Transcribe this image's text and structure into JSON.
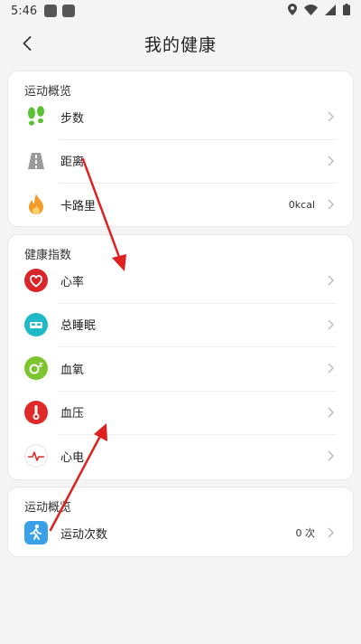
{
  "status": {
    "time": "5:46"
  },
  "header": {
    "title": "我的健康"
  },
  "section1": {
    "title": "运动概览",
    "items": [
      {
        "label": "步数",
        "value": ""
      },
      {
        "label": "距离",
        "value": ""
      },
      {
        "label": "卡路里",
        "value": "0kcal"
      }
    ]
  },
  "section2": {
    "title": "健康指数",
    "items": [
      {
        "label": "心率"
      },
      {
        "label": "总睡眠"
      },
      {
        "label": "血氧"
      },
      {
        "label": "血压"
      },
      {
        "label": "心电"
      }
    ]
  },
  "section3": {
    "title": "运动概览",
    "items": [
      {
        "label": "运动次数",
        "value": "0 次"
      }
    ]
  },
  "icons": {
    "steps": "footprints-icon",
    "distance": "road-icon",
    "calories": "flame-icon",
    "heart": "heart-icon",
    "sleep": "bed-icon",
    "oxygen": "o2-icon",
    "pressure": "thermometer-icon",
    "ecg": "ecg-icon",
    "exercise": "runner-icon"
  },
  "colors": {
    "green": "#5bc236",
    "orange": "#f39a2a",
    "red": "#e02a2a",
    "cyan": "#1fb9c9",
    "lime": "#7cc52c",
    "blue": "#3aa0e8"
  }
}
